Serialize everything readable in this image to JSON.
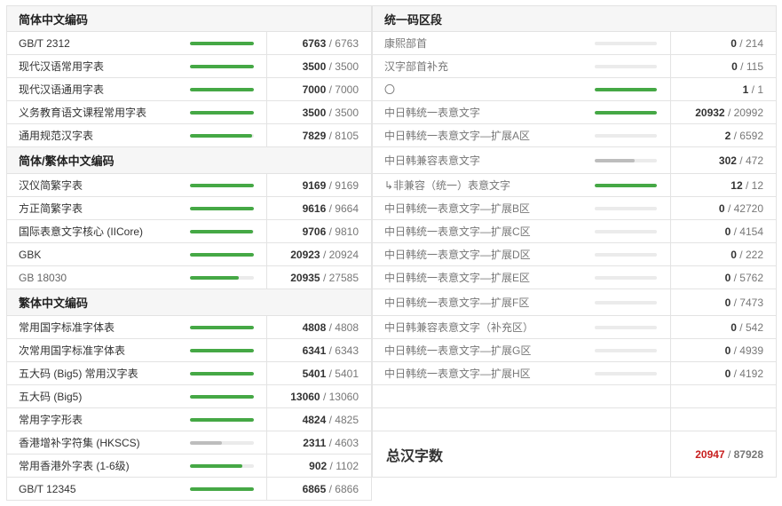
{
  "colors": {
    "green": "#45a845",
    "grey": "#bdbdbd",
    "track": "#ebebeb",
    "red": "#c82020"
  },
  "left": [
    {
      "type": "header",
      "title": "简体中文编码",
      "h": 30
    },
    {
      "type": "row",
      "name": "GB/T 2312",
      "cur": "6763",
      "total": "6763",
      "pct": 1,
      "color": "green",
      "h": 26
    },
    {
      "type": "row",
      "name": "现代汉语常用字表",
      "cur": "3500",
      "total": "3500",
      "pct": 1,
      "color": "green",
      "h": 26
    },
    {
      "type": "row",
      "name": "现代汉语通用字表",
      "cur": "7000",
      "total": "7000",
      "pct": 1,
      "color": "green",
      "h": 26
    },
    {
      "type": "row",
      "name": "义务教育语文课程常用字表",
      "cur": "3500",
      "total": "3500",
      "pct": 1,
      "color": "green",
      "h": 26
    },
    {
      "type": "row",
      "name": "通用规范汉字表",
      "cur": "7829",
      "total": "8105",
      "pct": 0.966,
      "color": "green",
      "h": 26
    },
    {
      "type": "header",
      "title": "简体/繁体中文编码",
      "h": 30
    },
    {
      "type": "row",
      "name": "汉仪简繁字表",
      "cur": "9169",
      "total": "9169",
      "pct": 1,
      "color": "green",
      "h": 26
    },
    {
      "type": "row",
      "name": "方正简繁字表",
      "cur": "9616",
      "total": "9664",
      "pct": 0.995,
      "color": "green",
      "h": 26
    },
    {
      "type": "row",
      "name": "国际表意文字核心 (IICore)",
      "cur": "9706",
      "total": "9810",
      "pct": 0.989,
      "color": "green",
      "h": 26
    },
    {
      "type": "row",
      "name": "GBK",
      "cur": "20923",
      "total": "20924",
      "pct": 1,
      "color": "green",
      "h": 26
    },
    {
      "type": "row",
      "name": "GB 18030",
      "cur": "20935",
      "total": "27585",
      "pct": 0.759,
      "color": "green",
      "grey_name": true,
      "h": 26
    },
    {
      "type": "header",
      "title": "繁体中文编码",
      "h": 30
    },
    {
      "type": "row",
      "name": "常用国字标准字体表",
      "cur": "4808",
      "total": "4808",
      "pct": 1,
      "color": "green",
      "h": 26
    },
    {
      "type": "row",
      "name": "次常用国字标准字体表",
      "cur": "6341",
      "total": "6343",
      "pct": 1,
      "color": "green",
      "h": 26
    },
    {
      "type": "row",
      "name": "五大码 (Big5) 常用汉字表",
      "cur": "5401",
      "total": "5401",
      "pct": 1,
      "color": "green",
      "h": 26
    },
    {
      "type": "row",
      "name": "五大码 (Big5)",
      "cur": "13060",
      "total": "13060",
      "pct": 1,
      "color": "green",
      "h": 26
    },
    {
      "type": "row",
      "name": "常用字字形表",
      "cur": "4824",
      "total": "4825",
      "pct": 1,
      "color": "green",
      "h": 26
    },
    {
      "type": "row",
      "name": "香港增补字符集 (HKSCS)",
      "cur": "2311",
      "total": "4603",
      "pct": 0.502,
      "color": "grey",
      "h": 26
    },
    {
      "type": "row",
      "name": "常用香港外字表 (1-6级)",
      "cur": "902",
      "total": "1102",
      "pct": 0.819,
      "color": "green",
      "h": 26
    },
    {
      "type": "row",
      "name": "GB/T 12345",
      "cur": "6865",
      "total": "6866",
      "pct": 1,
      "color": "green",
      "h": 26
    }
  ],
  "right": [
    {
      "type": "header",
      "title": "统一码区段",
      "h": 30
    },
    {
      "type": "row",
      "name": "康熙部首",
      "cur": "0",
      "total": "214",
      "pct": 0,
      "color": "green",
      "h": 26
    },
    {
      "type": "row",
      "name": "汉字部首补充",
      "cur": "0",
      "total": "115",
      "pct": 0,
      "color": "green",
      "h": 26
    },
    {
      "type": "row",
      "name": "〇",
      "cur": "1",
      "total": "1",
      "pct": 1,
      "color": "green",
      "h": 26
    },
    {
      "type": "row",
      "name": "中日韩统一表意文字",
      "cur": "20932",
      "total": "20992",
      "pct": 0.997,
      "color": "green",
      "h": 26
    },
    {
      "type": "row",
      "name": "中日韩统一表意文字—扩展A区",
      "cur": "2",
      "total": "6592",
      "pct": 0,
      "color": "green",
      "h": 26
    },
    {
      "type": "row",
      "name": "中日韩兼容表意文字",
      "cur": "302",
      "total": "472",
      "pct": 0.64,
      "color": "grey",
      "h": 30
    },
    {
      "type": "row",
      "name": "↳非兼容（统一）表意文字",
      "cur": "12",
      "total": "12",
      "pct": 1,
      "color": "green",
      "h": 26
    },
    {
      "type": "row",
      "name": "中日韩统一表意文字—扩展B区",
      "cur": "0",
      "total": "42720",
      "pct": 0,
      "color": "green",
      "h": 26
    },
    {
      "type": "row",
      "name": "中日韩统一表意文字—扩展C区",
      "cur": "0",
      "total": "4154",
      "pct": 0,
      "color": "green",
      "h": 26
    },
    {
      "type": "row",
      "name": "中日韩统一表意文字—扩展D区",
      "cur": "0",
      "total": "222",
      "pct": 0,
      "color": "green",
      "h": 26
    },
    {
      "type": "row",
      "name": "中日韩统一表意文字—扩展E区",
      "cur": "0",
      "total": "5762",
      "pct": 0,
      "color": "green",
      "h": 26
    },
    {
      "type": "row",
      "name": "中日韩统一表意文字—扩展F区",
      "cur": "0",
      "total": "7473",
      "pct": 0,
      "color": "green",
      "h": 30
    },
    {
      "type": "row",
      "name": "中日韩兼容表意文字（补充区）",
      "cur": "0",
      "total": "542",
      "pct": 0,
      "color": "green",
      "h": 26
    },
    {
      "type": "row",
      "name": "中日韩统一表意文字—扩展G区",
      "cur": "0",
      "total": "4939",
      "pct": 0,
      "color": "green",
      "h": 26
    },
    {
      "type": "row",
      "name": "中日韩统一表意文字—扩展H区",
      "cur": "0",
      "total": "4192",
      "pct": 0,
      "color": "green",
      "h": 26
    },
    {
      "type": "empty",
      "h": 26
    },
    {
      "type": "empty",
      "h": 26
    },
    {
      "type": "total",
      "name": "总汉字数",
      "cur": "20947",
      "total": "87928",
      "h": 52
    }
  ]
}
